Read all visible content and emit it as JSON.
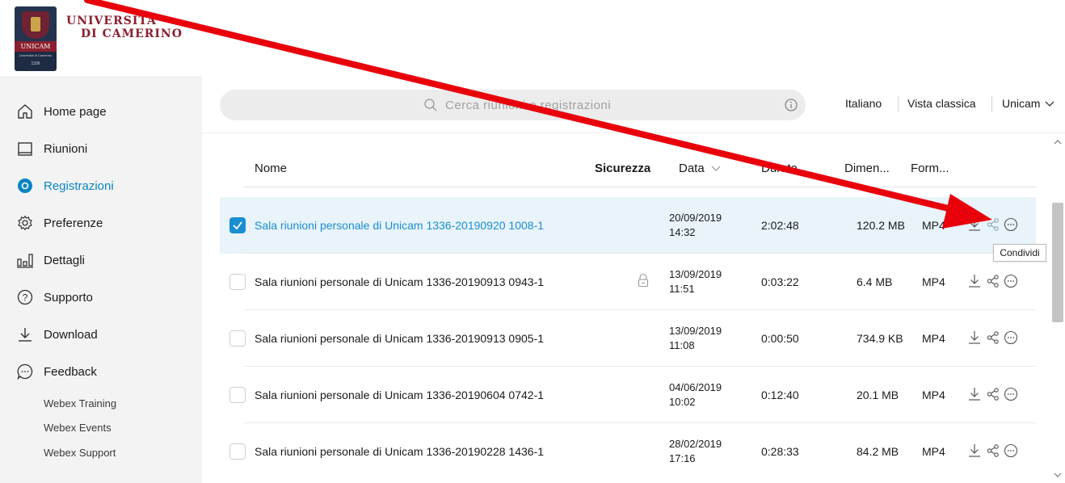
{
  "brand": {
    "university_line1": "UNIVERSITÀ",
    "university_line2": "DI CAMERINO",
    "crest_band": "UNICAM",
    "crest_small": "Università di Camerino",
    "crest_year": "1336"
  },
  "sidebar": {
    "items": [
      {
        "label": "Home page",
        "icon": "home-icon"
      },
      {
        "label": "Riunioni",
        "icon": "calendar-icon"
      },
      {
        "label": "Registrazioni",
        "icon": "record-icon",
        "active": true
      },
      {
        "label": "Preferenze",
        "icon": "gear-icon"
      },
      {
        "label": "Dettagli",
        "icon": "bar-chart-icon"
      },
      {
        "label": "Supporto",
        "icon": "help-icon"
      },
      {
        "label": "Download",
        "icon": "download-icon"
      },
      {
        "label": "Feedback",
        "icon": "chat-icon"
      }
    ],
    "links": [
      "Webex Training",
      "Webex Events",
      "Webex Support"
    ]
  },
  "topbar": {
    "search_placeholder": "Cerca riunioni e registrazioni",
    "language": "Italiano",
    "classic_view": "Vista classica",
    "account": "Unicam"
  },
  "table": {
    "headers": {
      "name": "Nome",
      "security": "Sicurezza",
      "date": "Data",
      "duration": "Durata",
      "size": "Dimen...",
      "format": "Form..."
    },
    "rows": [
      {
        "name": "Sala riunioni personale di Unicam 1336-20190920 1008-1",
        "date": "20/09/2019",
        "time": "14:32",
        "duration": "2:02:48",
        "size": "120.2 MB",
        "format": "MP4",
        "selected": true,
        "locked": false
      },
      {
        "name": "Sala riunioni personale di Unicam 1336-20190913 0943-1",
        "date": "13/09/2019",
        "time": "11:51",
        "duration": "0:03:22",
        "size": "6.4 MB",
        "format": "MP4",
        "selected": false,
        "locked": true
      },
      {
        "name": "Sala riunioni personale di Unicam 1336-20190913 0905-1",
        "date": "13/09/2019",
        "time": "11:08",
        "duration": "0:00:50",
        "size": "734.9 KB",
        "format": "MP4",
        "selected": false,
        "locked": false
      },
      {
        "name": "Sala riunioni personale di Unicam 1336-20190604 0742-1",
        "date": "04/06/2019",
        "time": "10:02",
        "duration": "0:12:40",
        "size": "20.1 MB",
        "format": "MP4",
        "selected": false,
        "locked": false
      },
      {
        "name": "Sala riunioni personale di Unicam 1336-20190228 1436-1",
        "date": "28/02/2019",
        "time": "17:16",
        "duration": "0:28:33",
        "size": "84.2 MB",
        "format": "MP4",
        "selected": false,
        "locked": false
      }
    ]
  },
  "tooltip": "Condividi",
  "colors": {
    "accent": "#1a8ed1",
    "selected_row": "#e8f3fa",
    "sidebar_bg": "#f3f3f3",
    "annotation_arrow": "#e8000b",
    "brand": "#8a1f2d"
  }
}
